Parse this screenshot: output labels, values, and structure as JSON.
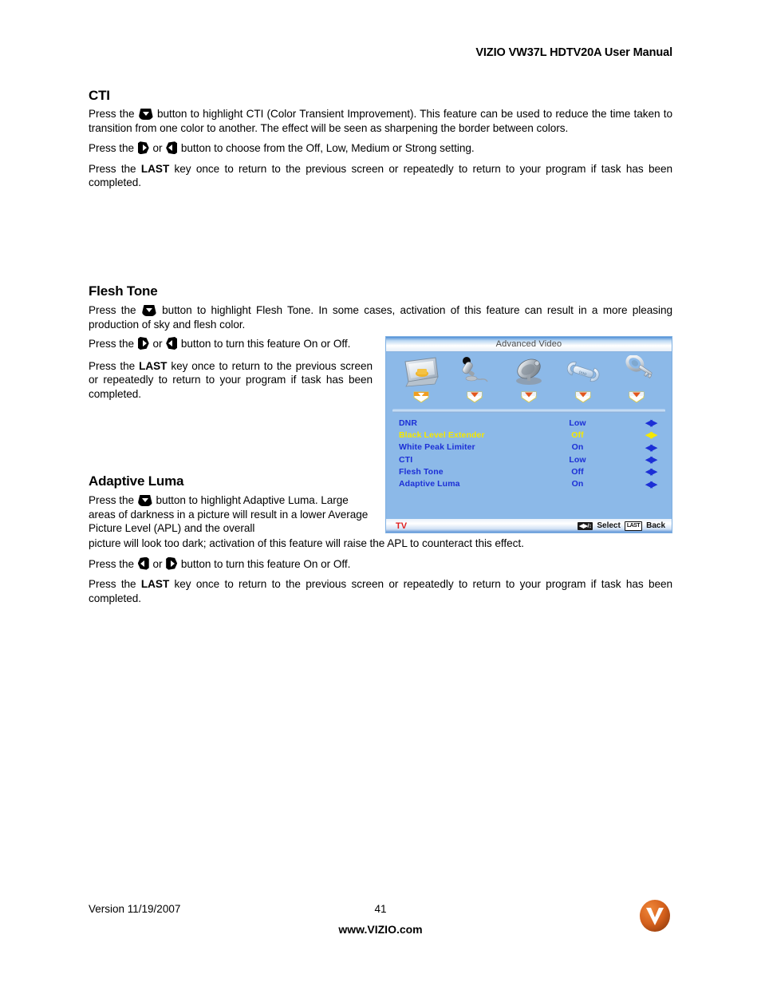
{
  "header": {
    "title": "VIZIO VW37L HDTV20A User Manual"
  },
  "sections": [
    {
      "heading": "CTI",
      "paragraphs": [
        {
          "parts": [
            {
              "t": "text",
              "v": "Press the"
            },
            {
              "t": "key",
              "v": "down"
            },
            {
              "t": "text",
              "v": "button to highlight CTI (Color Transient Improvement).  This feature can be used to reduce the time taken to transition from one color to another.  The effect will be seen as sharpening the border between colors."
            }
          ]
        },
        {
          "parts": [
            {
              "t": "text",
              "v": "Press the"
            },
            {
              "t": "key",
              "v": "right"
            },
            {
              "t": "text",
              "v": "or"
            },
            {
              "t": "key",
              "v": "left"
            },
            {
              "t": "text",
              "v": "button to choose from the Off, Low, Medium or Strong setting."
            }
          ]
        },
        {
          "parts": [
            {
              "t": "text",
              "v": "Press the"
            },
            {
              "t": "bold",
              "v": "LAST"
            },
            {
              "t": "text",
              "v": "key once to return to the previous screen or repeatedly to return to your program if task has been completed."
            }
          ]
        }
      ]
    },
    {
      "heading": "Flesh Tone",
      "paragraphs": [
        {
          "parts": [
            {
              "t": "text",
              "v": "Press the"
            },
            {
              "t": "key",
              "v": "down"
            },
            {
              "t": "text",
              "v": "button to highlight Flesh Tone.  In some cases, activation of this feature can result in a more pleasing production of sky and flesh color."
            }
          ]
        },
        {
          "parts": [
            {
              "t": "text",
              "v": "Press the"
            },
            {
              "t": "key",
              "v": "right"
            },
            {
              "t": "text",
              "v": "or"
            },
            {
              "t": "key",
              "v": "left"
            },
            {
              "t": "text",
              "v": "button to turn this feature On or Off."
            }
          ]
        },
        {
          "parts": [
            {
              "t": "text",
              "v": "Press the"
            },
            {
              "t": "bold",
              "v": "LAST"
            },
            {
              "t": "text",
              "v": "key once to return to the previous screen or repeatedly to return to your program if task has been completed."
            }
          ]
        }
      ]
    },
    {
      "heading": "Adaptive Luma",
      "paragraphs": [
        {
          "parts": [
            {
              "t": "text",
              "v": "Press the"
            },
            {
              "t": "key",
              "v": "down"
            },
            {
              "t": "text",
              "v": "button to highlight Adaptive Luma. Large areas of darkness in a picture will result in a lower Average Picture Level (APL) and the overall"
            }
          ]
        },
        {
          "parts": [
            {
              "t": "text",
              "v": "picture will look too dark; activation of this feature will raise the APL to counteract this effect."
            }
          ]
        },
        {
          "parts": [
            {
              "t": "text",
              "v": "Press the"
            },
            {
              "t": "key",
              "v": "left"
            },
            {
              "t": "text",
              "v": "or"
            },
            {
              "t": "key",
              "v": "right"
            },
            {
              "t": "text",
              "v": "button to turn this feature On or Off."
            }
          ]
        },
        {
          "parts": [
            {
              "t": "text",
              "v": "Press the"
            },
            {
              "t": "bold",
              "v": "LAST"
            },
            {
              "t": "text",
              "v": "key once to return to the previous screen or repeatedly to return to your program if task has been completed."
            }
          ]
        }
      ]
    }
  ],
  "osd": {
    "title": "Advanced Video",
    "icons": [
      {
        "name": "picture-screen-icon",
        "label": "Picture",
        "selected": true
      },
      {
        "name": "microphone-icon",
        "label": "Audio",
        "selected": false
      },
      {
        "name": "satellite-dish-icon",
        "label": "Tuner",
        "selected": false
      },
      {
        "name": "wrench-icon",
        "label": "Setup",
        "selected": false
      },
      {
        "name": "key-icon",
        "label": "Parental",
        "selected": false
      }
    ],
    "rows": [
      {
        "label": "DNR",
        "value": "Low",
        "selected": false
      },
      {
        "label": "Black Level Extender",
        "value": "Off",
        "selected": true
      },
      {
        "label": "White Peak Limiter",
        "value": "On",
        "selected": false
      },
      {
        "label": "CTI",
        "value": "Low",
        "selected": false
      },
      {
        "label": "Flesh Tone",
        "value": "Off",
        "selected": false
      },
      {
        "label": "Adaptive Luma",
        "value": "On",
        "selected": false
      }
    ],
    "footer": {
      "source": "TV",
      "nav_keycap": "◀▶/↕",
      "select_label": "Select",
      "last_keycap": "LAST",
      "back_label": "Back"
    },
    "colors": {
      "background": "#8cb9e8",
      "item_text": "#1c2fd6",
      "item_selected_text": "#f5e800",
      "source_text": "#e02020"
    }
  },
  "page_footer": {
    "version": "Version 11/19/2007",
    "page_number": "41",
    "website": "www.VIZIO.com",
    "logo_letter": "V",
    "logo_color": "#d4601c"
  }
}
